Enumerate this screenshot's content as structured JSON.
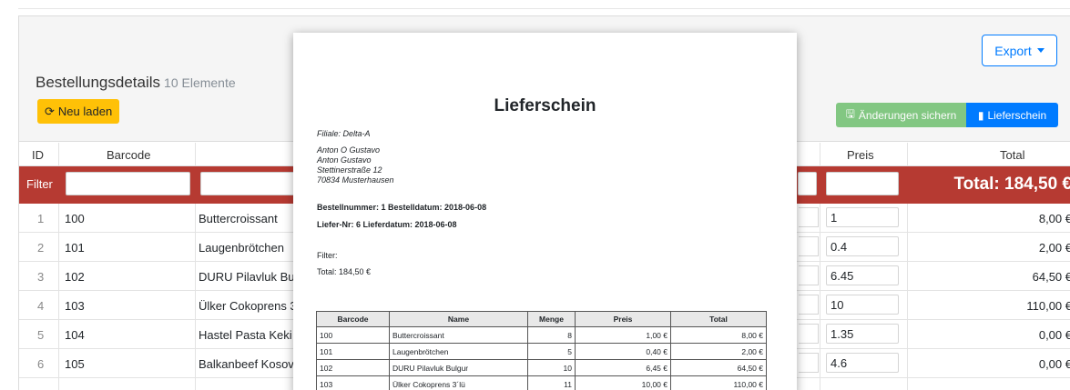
{
  "page": {
    "title": "Bestellungsdetails",
    "count": "10 Elemente",
    "reload_label": "Neu laden",
    "export_label": "Export",
    "save_label": "Änderungen sichern",
    "slip_label": "Lieferschein"
  },
  "table": {
    "headers": {
      "id": "ID",
      "barcode": "Barcode",
      "preis": "Preis",
      "total": "Total"
    },
    "filter_label": "Filter",
    "filter_total": "Total: 184,50 €",
    "rows": [
      {
        "id": "1",
        "barcode": "100",
        "name": "Buttercroissant",
        "preis": "1",
        "total": "8,00 €"
      },
      {
        "id": "2",
        "barcode": "101",
        "name": "Laugenbrötchen",
        "preis": "0.4",
        "total": "2,00 €"
      },
      {
        "id": "3",
        "barcode": "102",
        "name": "DURU Pilavluk Bul",
        "preis": "6.45",
        "total": "64,50 €"
      },
      {
        "id": "4",
        "barcode": "103",
        "name": "Ülker Cokoprens 3",
        "preis": "10",
        "total": "110,00 €"
      },
      {
        "id": "5",
        "barcode": "104",
        "name": "Hastel Pasta Keki",
        "preis": "1.35",
        "total": "0,00 €"
      },
      {
        "id": "6",
        "barcode": "105",
        "name": "Balkanbeef Kosov",
        "preis": "4.6",
        "total": "0,00 €"
      }
    ]
  },
  "modal": {
    "title": "Lieferschein",
    "filiale": "Filiale: Delta-A",
    "address": [
      "Anton O Gustavo",
      "Anton Gustavo",
      "Stettinerstraße 12",
      "70834 Musterhausen"
    ],
    "order_line": "Bestellnummer: 1  Bestelldatum: 2018-06-08",
    "delivery_line": "Liefer-Nr: 6  Lieferdatum: 2018-06-08",
    "filter": "Filter:",
    "total": "Total: 184,50 €",
    "headers": [
      "Barcode",
      "Name",
      "Menge",
      "Preis",
      "Total"
    ],
    "rows": [
      [
        "100",
        "Buttercroissant",
        "8",
        "1,00 €",
        "8,00 €"
      ],
      [
        "101",
        "Laugenbrötchen",
        "5",
        "0,40 €",
        "2,00 €"
      ],
      [
        "102",
        "DURU Pilavluk Bulgur",
        "10",
        "6,45 €",
        "64,50 €"
      ],
      [
        "103",
        "Ülker Cokoprens 3´lü",
        "11",
        "10,00 €",
        "110,00 €"
      ]
    ]
  }
}
